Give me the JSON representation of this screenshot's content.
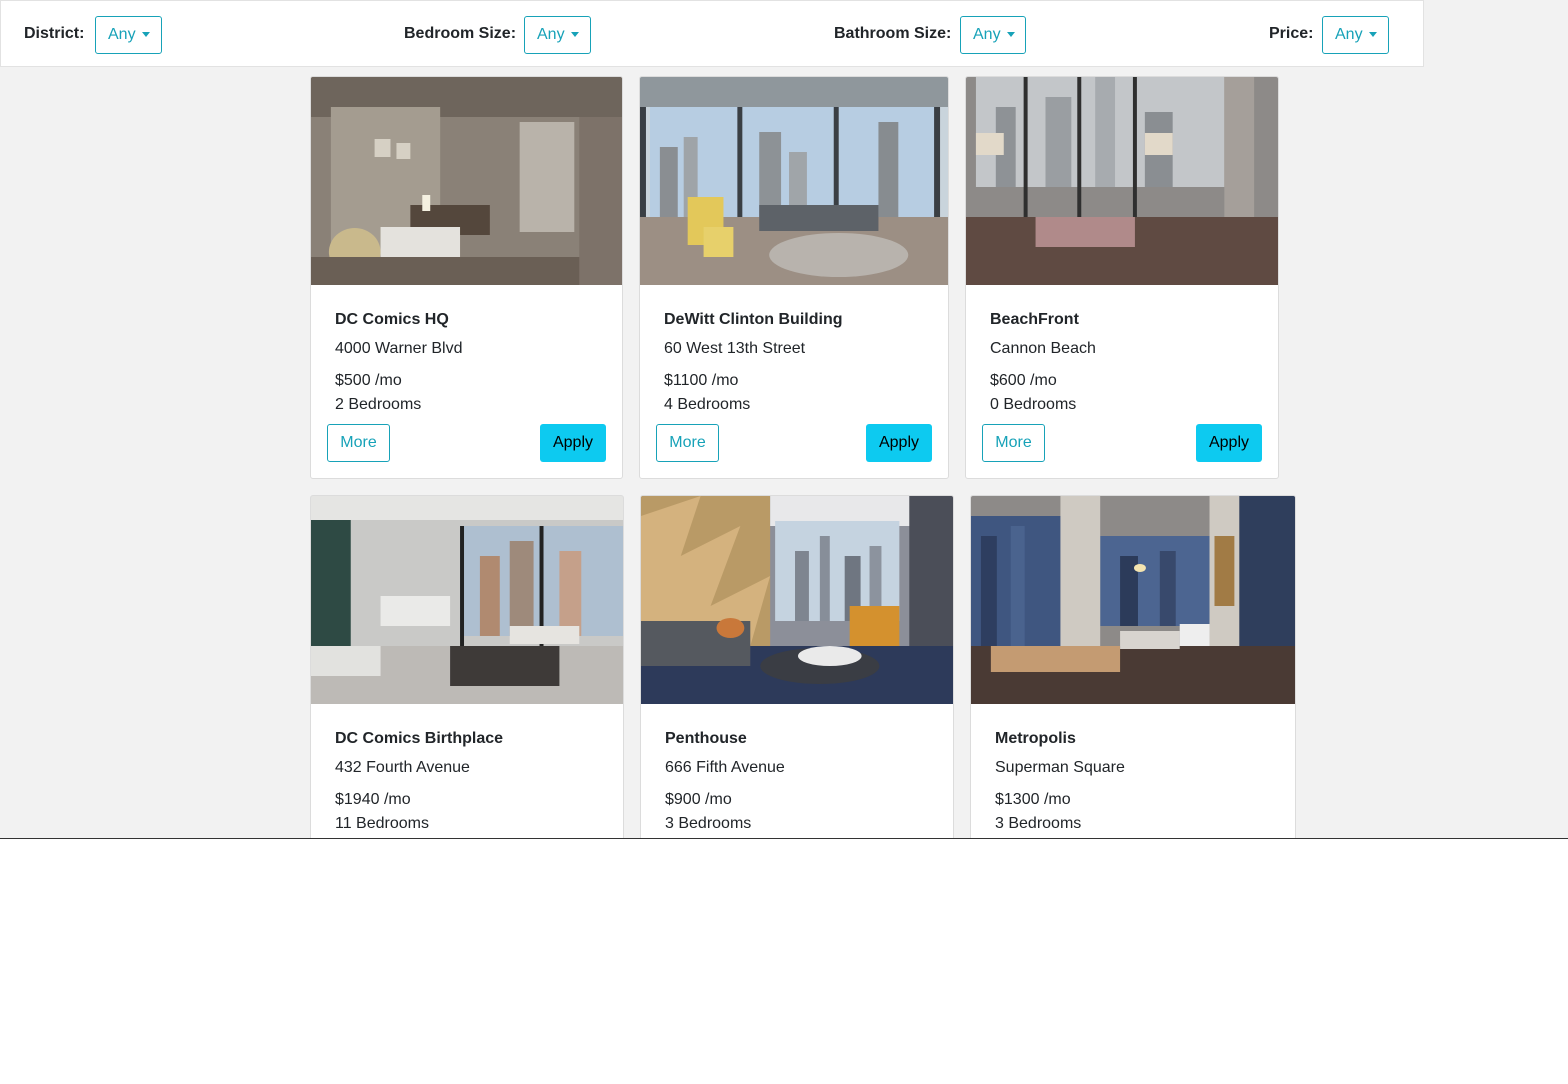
{
  "filters": {
    "district": {
      "label": "District:",
      "value": "Any"
    },
    "bedroom": {
      "label": "Bedroom Size:",
      "value": "Any"
    },
    "bathroom": {
      "label": "Bathroom Size:",
      "value": "Any"
    },
    "price": {
      "label": "Price:",
      "value": "Any"
    }
  },
  "listings": [
    {
      "title": "DC Comics HQ",
      "address": "4000 Warner Blvd",
      "price": "$500 /mo",
      "bedrooms": "2 Bedrooms",
      "more_label": "More",
      "apply_label": "Apply"
    },
    {
      "title": "DeWitt Clinton Building",
      "address": "60 West 13th Street",
      "price": "$1100 /mo",
      "bedrooms": "4 Bedrooms",
      "more_label": "More",
      "apply_label": "Apply"
    },
    {
      "title": "BeachFront",
      "address": "Cannon Beach",
      "price": "$600 /mo",
      "bedrooms": "0 Bedrooms",
      "more_label": "More",
      "apply_label": "Apply"
    },
    {
      "title": "DC Comics Birthplace",
      "address": "432 Fourth Avenue",
      "price": "$1940 /mo",
      "bedrooms": "11 Bedrooms"
    },
    {
      "title": "Penthouse",
      "address": "666 Fifth Avenue",
      "price": "$900 /mo",
      "bedrooms": "3 Bedrooms"
    },
    {
      "title": "Metropolis",
      "address": "Superman Square",
      "price": "$1300 /mo",
      "bedrooms": "3 Bedrooms"
    }
  ],
  "colors": {
    "accent": "#17a2b8",
    "apply": "#0dcaf0",
    "background": "#f2f2f2"
  }
}
